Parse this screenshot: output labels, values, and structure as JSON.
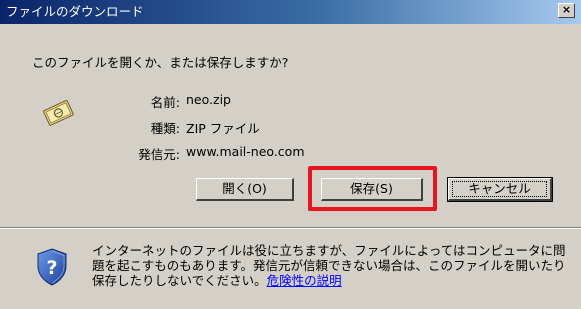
{
  "window": {
    "title": "ファイルのダウンロード",
    "close_label": "×"
  },
  "dialog": {
    "question": "このファイルを開くか、または保存しますか?",
    "file_icon": "zip-file-icon",
    "info": [
      {
        "label": "名前:",
        "value": "neo.zip"
      },
      {
        "label": "種類:",
        "value": "ZIP ファイル"
      },
      {
        "label": "発信元:",
        "value": "www.mail-neo.com"
      }
    ],
    "buttons": {
      "open": "開く(O)",
      "save": "保存(S)",
      "cancel": "キャンセル"
    },
    "highlight_color": "#e8141e"
  },
  "warning": {
    "icon": "shield-question-icon",
    "text": "インターネットのファイルは役に立ちますが、ファイルによってはコンピュータに問題を起こすものもあります。発信元が信頼できない場合は、このファイルを開いたり保存したりしないでください。",
    "link_text": "危険性の説明"
  }
}
